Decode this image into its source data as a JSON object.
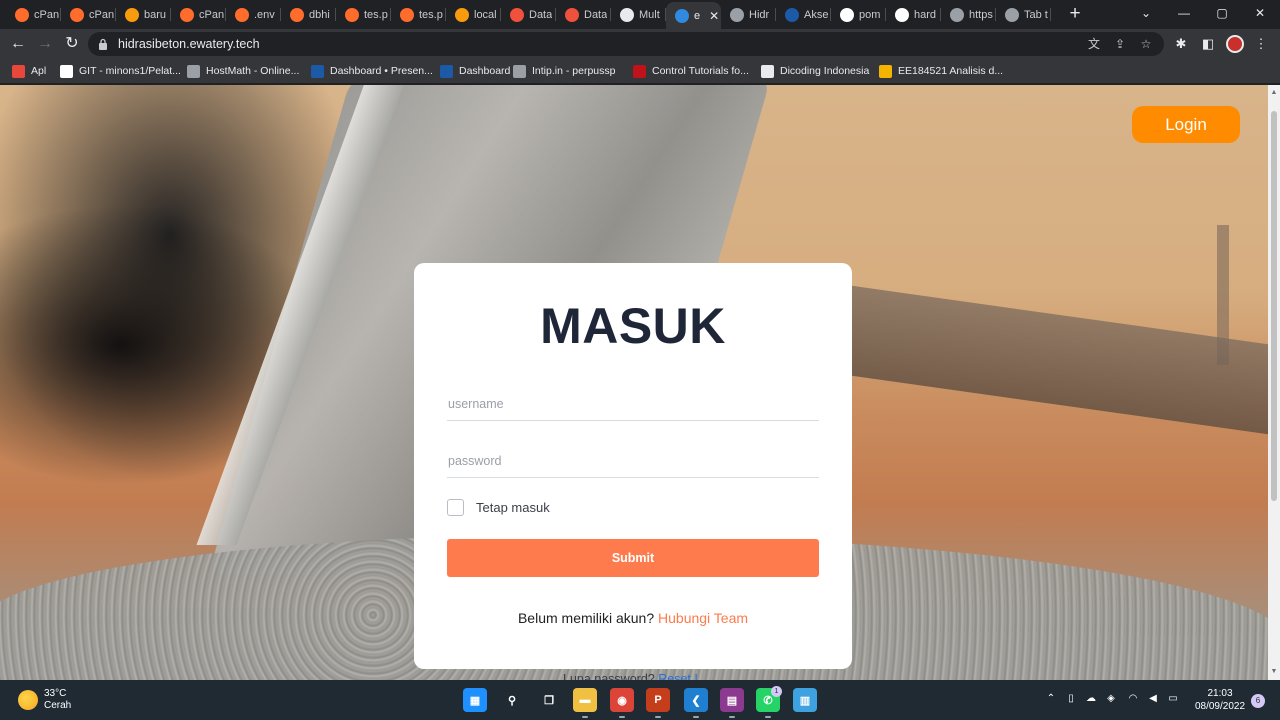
{
  "browser": {
    "tabs": [
      {
        "label": "cPan",
        "favicon": "cpanel-icon",
        "color": "#ff6c2c"
      },
      {
        "label": "cPan",
        "favicon": "cpanel-icon",
        "color": "#ff6c2c"
      },
      {
        "label": "baru",
        "favicon": "phpmyadmin-icon",
        "color": "#f89c0e"
      },
      {
        "label": "cPan",
        "favicon": "cpanel-icon",
        "color": "#ff6c2c"
      },
      {
        "label": ".env",
        "favicon": "cpanel-icon",
        "color": "#ff6c2c"
      },
      {
        "label": "dbhi",
        "favicon": "cpanel-icon",
        "color": "#ff6c2c"
      },
      {
        "label": "tes.p",
        "favicon": "cpanel-icon",
        "color": "#ff6c2c"
      },
      {
        "label": "tes.p",
        "favicon": "cpanel-icon",
        "color": "#ff6c2c"
      },
      {
        "label": "local",
        "favicon": "phpmyadmin-icon",
        "color": "#f89c0e"
      },
      {
        "label": "Data",
        "favicon": "laravel-icon",
        "color": "#f0513c"
      },
      {
        "label": "Data",
        "favicon": "laravel-icon",
        "color": "#f0513c"
      },
      {
        "label": "Mult",
        "favicon": "cube-icon",
        "color": "#e8eaed"
      },
      {
        "label": "e",
        "favicon": "vscode-icon",
        "color": "#2f8ae0"
      },
      {
        "label": "Hidr",
        "favicon": "globe-icon",
        "color": "#9aa0a6"
      },
      {
        "label": "Akse",
        "favicon": "its-icon",
        "color": "#1c5aa8"
      },
      {
        "label": "pom",
        "favicon": "google-icon",
        "color": "#ffffff"
      },
      {
        "label": "hard",
        "favicon": "google-icon",
        "color": "#ffffff"
      },
      {
        "label": "https",
        "favicon": "globe-icon",
        "color": "#9aa0a6"
      },
      {
        "label": "Tab t",
        "favicon": "chrome-icon",
        "color": "#9aa0a6"
      }
    ],
    "active_tab_index": 12,
    "url": "hidrasibeton.ewatery.tech",
    "bookmarks": [
      {
        "label": "Apl",
        "icon": "apps-grid-icon",
        "color": "#e8473c"
      },
      {
        "label": "GIT - minons1/Pelat...",
        "icon": "github-icon",
        "color": "#ffffff"
      },
      {
        "label": "HostMath - Online...",
        "icon": "globe-icon",
        "color": "#9aa0a6"
      },
      {
        "label": "Dashboard • Presen...",
        "icon": "its-icon",
        "color": "#1c5aa8"
      },
      {
        "label": "Dashboard",
        "icon": "its-icon",
        "color": "#1c5aa8"
      },
      {
        "label": "Intip.in - perpussp",
        "icon": "search-icon",
        "color": "#9aa0a6"
      },
      {
        "label": "Control Tutorials fo...",
        "icon": "control-icon",
        "color": "#c0121a"
      },
      {
        "label": "Dicoding Indonesia",
        "icon": "dicoding-icon",
        "color": "#e8eaed"
      },
      {
        "label": "EE184521 Analisis d...",
        "icon": "drive-icon",
        "color": "#f4b400"
      }
    ]
  },
  "page": {
    "login_button": "Login",
    "form": {
      "title": "MASUK",
      "username_placeholder": "username",
      "password_placeholder": "password",
      "remember_label": "Tetap masuk",
      "submit_label": "Submit",
      "signup_prompt": "Belum memiliki akun?",
      "signup_link": "Hubungi Team"
    },
    "forgot_prompt": "Lupa password?",
    "forgot_link": "Reset !",
    "accent_color": "#fe7b4d",
    "login_color": "#ff8c00"
  },
  "taskbar": {
    "weather_temp": "33°C",
    "weather_desc": "Cerah",
    "apps": [
      {
        "name": "windows-start-icon",
        "color": "#1e90ff",
        "glyph": "▦"
      },
      {
        "name": "search-icon",
        "color": "transparent",
        "glyph": "⚲"
      },
      {
        "name": "task-view-icon",
        "color": "transparent",
        "glyph": "❐"
      },
      {
        "name": "file-explorer-icon",
        "color": "#f0c043",
        "glyph": "▬"
      },
      {
        "name": "chrome-icon",
        "color": "#db4437",
        "glyph": "◉"
      },
      {
        "name": "powerpoint-icon",
        "color": "#c43e1c",
        "glyph": "P"
      },
      {
        "name": "vscode-icon",
        "color": "#1f7fd1",
        "glyph": "❮"
      },
      {
        "name": "winrar-icon",
        "color": "#8b3a8f",
        "glyph": "▤"
      },
      {
        "name": "whatsapp-icon",
        "color": "#25d366",
        "glyph": "✆"
      },
      {
        "name": "notepad-icon",
        "color": "#3fa2e0",
        "glyph": "▥"
      }
    ],
    "whatsapp_badge": "1",
    "time": "21:03",
    "date": "08/09/2022",
    "notification_count": "6"
  }
}
